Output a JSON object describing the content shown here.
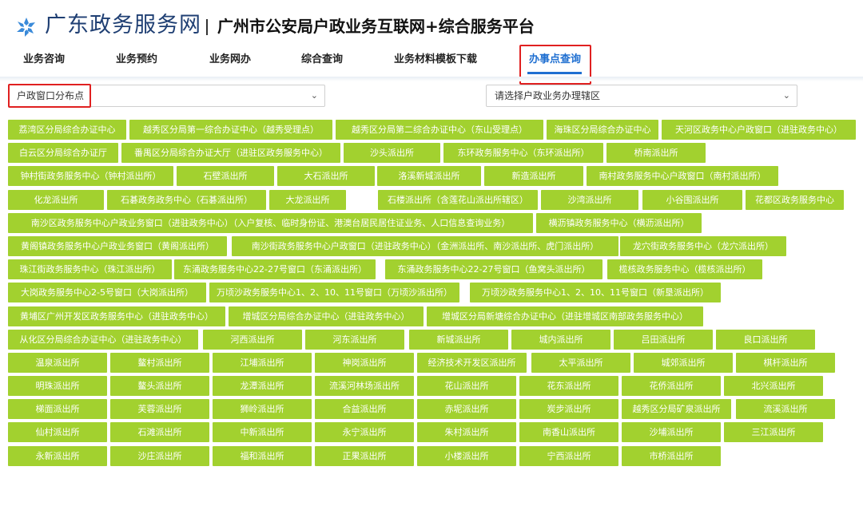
{
  "brand": {
    "name": "广东政务服务网",
    "platform_title": "广州市公安局户政业务互联网+综合服务平台"
  },
  "nav": [
    {
      "label": "业务咨询"
    },
    {
      "label": "业务预约"
    },
    {
      "label": "业务网办"
    },
    {
      "label": "综合查询"
    },
    {
      "label": "业务材料模板下载"
    },
    {
      "label": "办事点查询",
      "active": true
    }
  ],
  "filters": {
    "category": {
      "value": "户政窗口分布点"
    },
    "district": {
      "value": "请选择户政业务办理辖区"
    }
  },
  "colors": {
    "button_bg": "#a2d12f",
    "accent": "#1f6fd1",
    "highlight": "#e02020",
    "brand": "#1f3f73"
  },
  "offices": [
    [
      "荔湾区分局综合办证中心",
      "越秀区分局第一综合办证中心（越秀受理点）",
      "越秀区分局第二综合办证中心（东山受理点）",
      "海珠区分局综合办证中心",
      "天河区政务中心户政窗口（进驻政务中心）"
    ],
    [
      "白云区分局综合办证厅",
      "番禺区分局综合办证大厅（进驻区政务服务中心）",
      "沙头派出所",
      "东环政务服务中心（东环派出所）",
      "桥南派出所"
    ],
    [
      "钟村街政务服务中心（钟村派出所）",
      "石壁派出所",
      "大石派出所",
      "洛溪新城派出所",
      "新造派出所",
      "南村政务服务中心户政窗口（南村派出所）"
    ],
    [
      "化龙派出所",
      "石碁政务政务中心（石碁派出所）",
      "大龙派出所",
      "石楼派出所（含莲花山派出所辖区）",
      "沙湾派出所",
      "小谷围派出所",
      "花都区政务服务中心"
    ],
    [
      "南沙区政务服务中心户政业务窗口（进驻政务中心）（入户复核、临时身份证、港澳台居民居住证业务、人口信息查询业务）",
      "横沥镇政务服务中心（横沥派出所）"
    ],
    [
      "黄阁镇政务服务中心户政业务窗口（黄阁派出所）",
      "南沙街政务服务中心户政窗口（进驻政务中心）（金洲派出所、南沙派出所、虎门派出所）",
      "龙穴街政务服务中心（龙穴派出所）"
    ],
    [
      "珠江街政务服务中心（珠江派出所）",
      "东涌政务服务中心22-27号窗口（东涌派出所）",
      "东涌政务服务中心22-27号窗口（鱼窝头派出所）",
      "榄核政务服务中心（榄核派出所）"
    ],
    [
      "大岗政务服务中心2-5号窗口（大岗派出所）",
      "万顷沙政务服务中心1、2、10、11号窗口（万顷沙派出所）",
      "万顷沙政务服务中心1、2、10、11号窗口（新垦派出所）"
    ],
    [
      "黄埔区广州开发区政务服务中心（进驻政务中心）",
      "增城区分局综合办证中心（进驻政务中心）",
      "增城区分局新塘综合办证中心（进驻增城区南部政务服务中心）"
    ],
    [
      "从化区分局综合办证中心（进驻政务中心）",
      "河西派出所",
      "河东派出所",
      "新城派出所",
      "城内派出所",
      "吕田派出所",
      "良口派出所"
    ],
    [
      "温泉派出所",
      "鳌村派出所",
      "江埔派出所",
      "神岗派出所",
      "经济技术开发区派出所",
      "太平派出所",
      "城郊派出所",
      "棋杆派出所"
    ],
    [
      "明珠派出所",
      "鳌头派出所",
      "龙潭派出所",
      "流溪河林场派出所",
      "花山派出所",
      "花东派出所",
      "花侨派出所",
      "北兴派出所"
    ],
    [
      "梯面派出所",
      "芙蓉派出所",
      "狮岭派出所",
      "合益派出所",
      "赤坭派出所",
      "炭步派出所",
      "越秀区分局矿泉派出所",
      "流溪派出所"
    ],
    [
      "仙村派出所",
      "石滩派出所",
      "中新派出所",
      "永宁派出所",
      "朱村派出所",
      "南香山派出所",
      "沙埔派出所",
      "三江派出所"
    ],
    [
      "永新派出所",
      "沙庄派出所",
      "福和派出所",
      "正果派出所",
      "小楼派出所",
      "宁西派出所",
      "市桥派出所"
    ]
  ]
}
